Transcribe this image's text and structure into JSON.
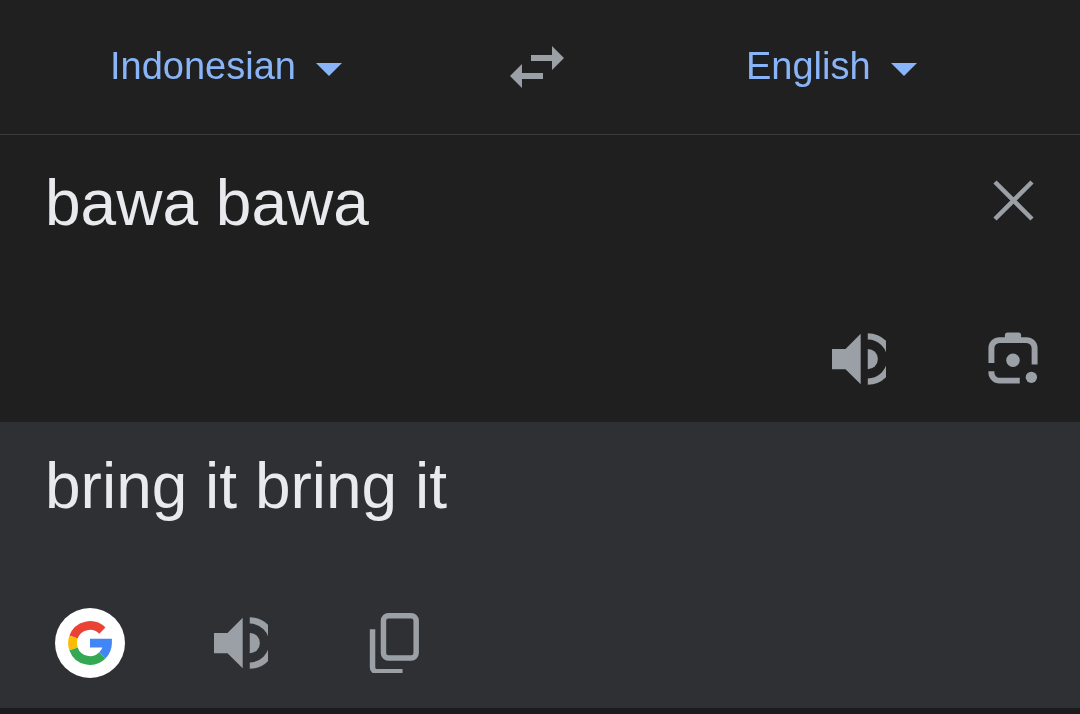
{
  "language_bar": {
    "source_language": "Indonesian",
    "target_language": "English"
  },
  "input": {
    "value": "bawa bawa"
  },
  "output": {
    "translation": "bring it bring it"
  }
}
